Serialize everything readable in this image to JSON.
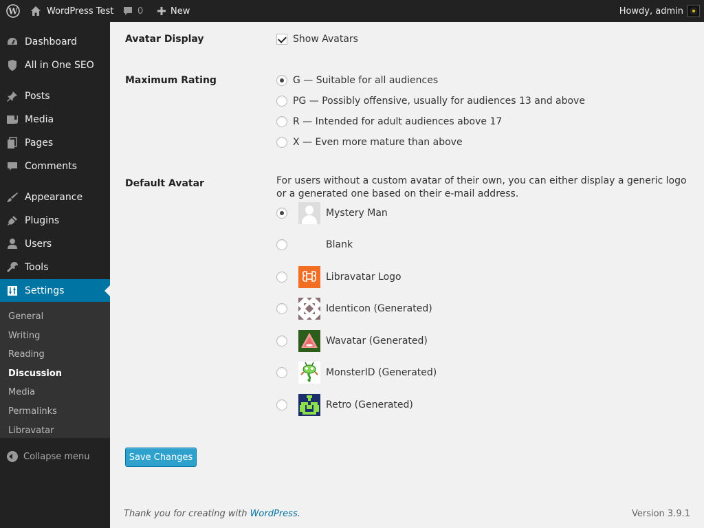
{
  "admin_bar": {
    "site_name": "WordPress Test",
    "comments_count": "0",
    "new_label": "New",
    "howdy": "Howdy, admin"
  },
  "menu": {
    "items": [
      {
        "label": "Dashboard",
        "icon": "dashboard-icon"
      },
      {
        "label": "All in One SEO",
        "icon": "shield-icon"
      },
      {
        "label": "Posts",
        "icon": "pin-icon"
      },
      {
        "label": "Media",
        "icon": "media-icon"
      },
      {
        "label": "Pages",
        "icon": "pages-icon"
      },
      {
        "label": "Comments",
        "icon": "comment-icon"
      },
      {
        "label": "Appearance",
        "icon": "brush-icon"
      },
      {
        "label": "Plugins",
        "icon": "plug-icon"
      },
      {
        "label": "Users",
        "icon": "user-icon"
      },
      {
        "label": "Tools",
        "icon": "wrench-icon"
      },
      {
        "label": "Settings",
        "icon": "settings-icon"
      }
    ],
    "submenu": [
      "General",
      "Writing",
      "Reading",
      "Discussion",
      "Media",
      "Permalinks",
      "Libravatar"
    ],
    "current_submenu": "Discussion",
    "collapse_label": "Collapse menu"
  },
  "avatar_display": {
    "label": "Avatar Display",
    "checkbox_label": "Show Avatars",
    "checked": true
  },
  "max_rating": {
    "label": "Maximum Rating",
    "options": [
      "G — Suitable for all audiences",
      "PG — Possibly offensive, usually for audiences 13 and above",
      "R — Intended for adult audiences above 17",
      "X — Even more mature than above"
    ],
    "selected_index": 0
  },
  "default_avatar": {
    "label": "Default Avatar",
    "description": "For users without a custom avatar of their own, you can either display a generic logo or a generated one based on their e-mail address.",
    "options": [
      "Mystery Man",
      "Blank",
      "Libravatar Logo",
      "Identicon (Generated)",
      "Wavatar (Generated)",
      "MonsterID (Generated)",
      "Retro (Generated)"
    ],
    "selected_index": 0
  },
  "save_button": "Save Changes",
  "footer": {
    "thanks_prefix": "Thank you for creating with ",
    "thanks_link": "WordPress",
    "thanks_suffix": ".",
    "version": "Version 3.9.1"
  },
  "colors": {
    "menu_bg": "#222222",
    "menu_current": "#0074a2",
    "button": "#2ea2cc",
    "link": "#0074a2"
  }
}
